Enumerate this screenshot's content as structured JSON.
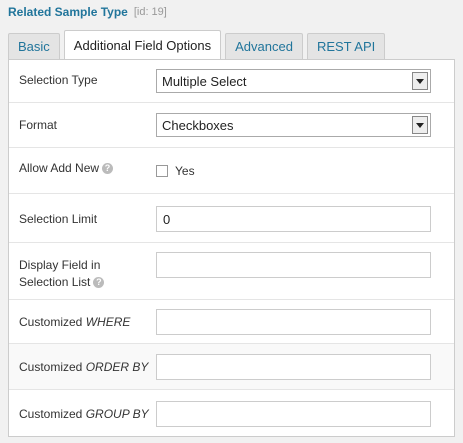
{
  "header": {
    "title": "Related Sample Type",
    "id_tag": "[id: 19]"
  },
  "tabs": [
    {
      "label": "Basic"
    },
    {
      "label": "Additional Field Options"
    },
    {
      "label": "Advanced"
    },
    {
      "label": "REST API"
    }
  ],
  "active_tab": "Additional Field Options",
  "fields": {
    "selection_type": {
      "label": "Selection Type",
      "value": "Multiple Select"
    },
    "format": {
      "label": "Format",
      "value": "Checkboxes"
    },
    "allow_add_new": {
      "label": "Allow Add New",
      "checkbox_label": "Yes",
      "checked": false
    },
    "selection_limit": {
      "label": "Selection Limit",
      "value": "0"
    },
    "display_field": {
      "label_line1": "Display Field in",
      "label_line2": "Selection List",
      "value": ""
    },
    "customized_where": {
      "label_prefix": "Customized ",
      "label_em": "WHERE",
      "value": ""
    },
    "customized_order_by": {
      "label_prefix": "Customized ",
      "label_em": "ORDER BY",
      "value": ""
    },
    "customized_group_by": {
      "label_prefix": "Customized ",
      "label_em": "GROUP BY",
      "value": ""
    }
  },
  "help_icon_glyph": "?",
  "colors": {
    "link": "#21759b",
    "tab_inactive_bg": "#e4e4e4",
    "panel_bg": "#ffffff"
  }
}
